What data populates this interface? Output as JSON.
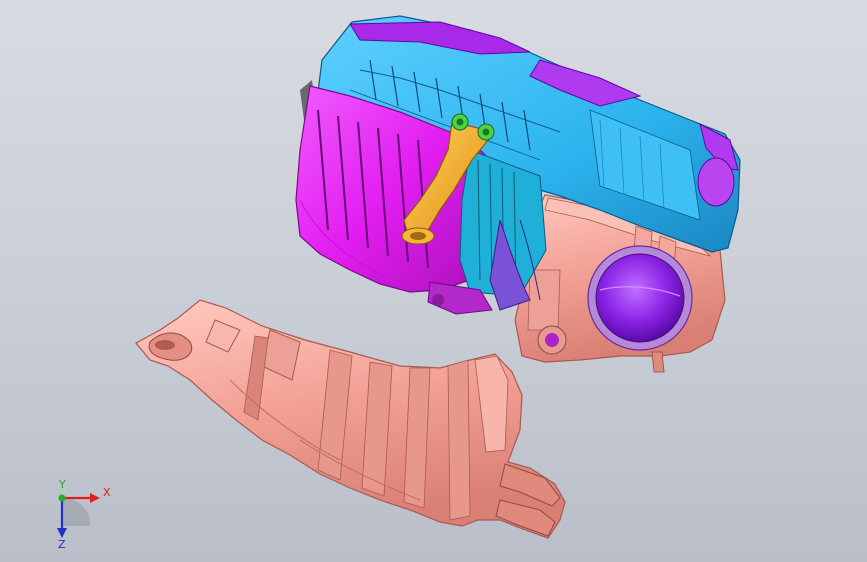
{
  "viewport": {
    "background": "#c9cdd5"
  },
  "model": {
    "parts": [
      {
        "name": "air-box-upper-cover",
        "color": "#2cb4ee"
      },
      {
        "name": "air-box-lower-housing",
        "color": "#e21df0"
      },
      {
        "name": "intake-duct",
        "color": "#f1a196"
      },
      {
        "name": "outlet-port",
        "color": "#9b2ff0"
      },
      {
        "name": "mounting-bracket",
        "color": "#f0a21c"
      },
      {
        "name": "filter-element",
        "color": "#7a52d6"
      },
      {
        "name": "sensor-pins",
        "color": "#4cd24c"
      }
    ]
  },
  "triad": {
    "x_label": "X",
    "y_label": "Y",
    "z_label": "Z",
    "x_color": "#e02020",
    "y_color": "#20b020",
    "z_color": "#2030c8"
  }
}
